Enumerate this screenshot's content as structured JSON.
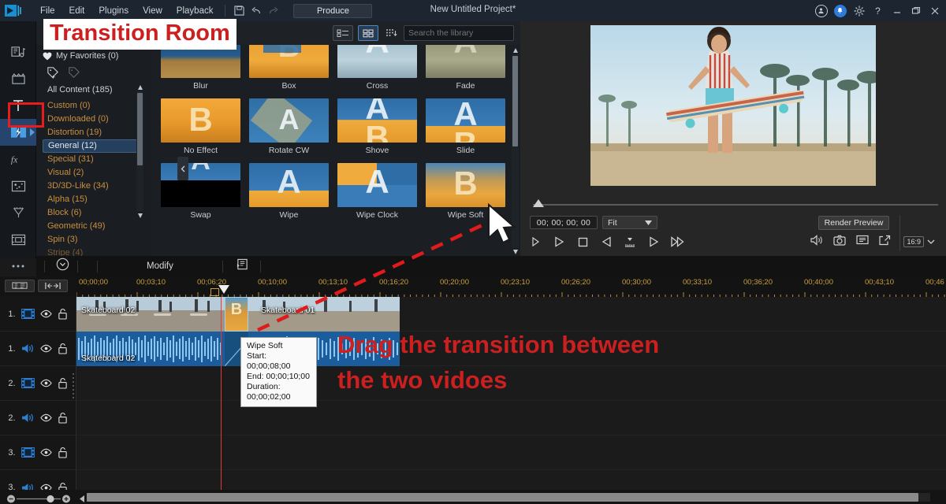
{
  "app": {
    "project_title": "New Untitled Project*",
    "logo_icon": "powerdirector-logo-icon"
  },
  "menubar": {
    "items": [
      {
        "label": "File"
      },
      {
        "label": "Edit"
      },
      {
        "label": "Plugins"
      },
      {
        "label": "View"
      },
      {
        "label": "Playback"
      }
    ],
    "save_icon": "save-disk-icon",
    "undo_icon": "undo-arrow-icon",
    "redo_icon": "redo-arrow-icon",
    "produce_label": "Produce"
  },
  "window_controls": {
    "account_icon": "account-circle-icon",
    "notification_icon": "bell-icon",
    "settings_icon": "gear-icon",
    "help_label": "?",
    "minimize_label": "—",
    "maximize_label": "❐",
    "close_label": "✕",
    "notification_color": "#2f7bdc"
  },
  "rail": {
    "items": [
      {
        "name": "media-room",
        "icon": "media-note-icon"
      },
      {
        "name": "effect-room",
        "icon": "clapper-board-icon"
      },
      {
        "name": "title-room",
        "icon": "text-t-icon"
      },
      {
        "name": "transition-room",
        "icon": "transition-icon",
        "active": true
      },
      {
        "name": "audio-mixing-room",
        "icon": "fx-icon"
      },
      {
        "name": "particle-room",
        "icon": "particle-icon"
      },
      {
        "name": "subtitle-room",
        "icon": "magic-wand-icon"
      },
      {
        "name": "chapter-room",
        "icon": "frame-icon"
      },
      {
        "name": "more-rooms",
        "icon": "ellipsis-icon"
      }
    ]
  },
  "library": {
    "view_list_icon": "list-view-icon",
    "view_grid_icon": "grid-view-icon",
    "sort_icon": "sort-download-icon",
    "search_placeholder": "Search the library",
    "search_value": "",
    "search_icon": "search-icon",
    "favorites_label": "My Favorites (0)",
    "favorites_icon": "heart-icon",
    "tag_add_icon": "tag-plus-icon",
    "tag_icon": "tag-icon",
    "all_content_label": "All Content (185)",
    "collapse_icon": "chevron-left-icon",
    "categories": [
      {
        "label": "Custom  (0)",
        "selected": false
      },
      {
        "label": "Downloaded  (0)",
        "selected": false
      },
      {
        "label": "Distortion  (19)",
        "selected": false
      },
      {
        "label": "General  (12)",
        "selected": true
      },
      {
        "label": "Special  (31)",
        "selected": false
      },
      {
        "label": "Visual  (2)",
        "selected": false
      },
      {
        "label": "3D/3D-Like  (34)",
        "selected": false
      },
      {
        "label": "Alpha  (15)",
        "selected": false
      },
      {
        "label": "Block  (6)",
        "selected": false
      },
      {
        "label": "Geometric  (49)",
        "selected": false
      },
      {
        "label": "Spin  (3)",
        "selected": false
      },
      {
        "label": "Stripe  (4)",
        "selected": false
      }
    ],
    "transitions": [
      {
        "label": "Blur",
        "style": "blur"
      },
      {
        "label": "Box",
        "style": "box"
      },
      {
        "label": "Cross",
        "style": "cross"
      },
      {
        "label": "Fade",
        "style": "fade"
      },
      {
        "label": "No Effect",
        "style": "noeffect"
      },
      {
        "label": "Rotate CW",
        "style": "rotatecw"
      },
      {
        "label": "Shove",
        "style": "shove"
      },
      {
        "label": "Slide",
        "style": "slide"
      },
      {
        "label": "Swap",
        "style": "swap"
      },
      {
        "label": "Wipe",
        "style": "wipe"
      },
      {
        "label": "Wipe Clock",
        "style": "wipeclock"
      },
      {
        "label": "Wipe Soft",
        "style": "wipesoft"
      }
    ]
  },
  "preview": {
    "timecode": "00; 00; 00; 00",
    "fit_label": "Fit",
    "fit_caret_icon": "chevron-down-icon",
    "render_preview_label": "Render Preview",
    "aspect_ratio_label": "16:9",
    "aspect_caret_icon": "chevron-down-icon",
    "transport": [
      {
        "name": "play-button",
        "icon": "play-icon"
      },
      {
        "name": "stop-button",
        "icon": "stop-icon"
      },
      {
        "name": "previous-frame-button",
        "icon": "prev-frame-icon"
      },
      {
        "name": "step-button",
        "icon": "step-marker-icon"
      },
      {
        "name": "next-frame-button",
        "icon": "next-frame-icon"
      },
      {
        "name": "fast-forward-button",
        "icon": "fast-forward-icon"
      }
    ],
    "right_controls": [
      {
        "name": "volume-button",
        "icon": "speaker-icon"
      },
      {
        "name": "snapshot-button",
        "icon": "camera-icon"
      },
      {
        "name": "display-options-button",
        "icon": "display-icon"
      },
      {
        "name": "undock-button",
        "icon": "popout-icon"
      }
    ]
  },
  "modify_bar": {
    "expand_icon": "chevron-down-circle-icon",
    "modify_label": "Modify",
    "designer_icon": "designer-panel-icon"
  },
  "timeline": {
    "tools": [
      {
        "name": "track-manager-button",
        "icon": "track-manager-icon"
      },
      {
        "name": "marker-button",
        "icon": "range-marker-icon"
      }
    ],
    "ruler_labels": [
      "00;00;00",
      "00;03;10",
      "00;06;20",
      "00;10;00",
      "00;13;10",
      "00;16;20",
      "00;20;00",
      "00;23;10",
      "00;26;20",
      "00;30;00",
      "00;33;10",
      "00;36;20",
      "00;40;00",
      "00;43;10",
      "00;46"
    ],
    "tracks": [
      {
        "num": "1.",
        "type": "video",
        "eye_icon": "eye-icon",
        "lock_icon": "unlock-icon"
      },
      {
        "num": "1.",
        "type": "audio",
        "eye_icon": "eye-icon",
        "lock_icon": "unlock-icon"
      },
      {
        "num": "2.",
        "type": "video",
        "eye_icon": "eye-icon",
        "lock_icon": "unlock-icon"
      },
      {
        "num": "2.",
        "type": "audio",
        "eye_icon": "eye-icon",
        "lock_icon": "unlock-icon"
      },
      {
        "num": "3.",
        "type": "video",
        "eye_icon": "eye-icon",
        "lock_icon": "unlock-icon"
      },
      {
        "num": "3.",
        "type": "audio",
        "eye_icon": "eye-icon",
        "lock_icon": "unlock-icon"
      }
    ],
    "clips": [
      {
        "label": "Skateboard 02",
        "track": "video1"
      },
      {
        "label": "Skateboard 01",
        "track": "video1"
      },
      {
        "label": "Skateboard 02",
        "track": "audio1"
      }
    ],
    "zoom_out_icon": "minus-circle-icon",
    "zoom_in_icon": "plus-circle-icon",
    "scroll_left_icon": "triangle-left-icon"
  },
  "tooltip": {
    "title": "Wipe Soft",
    "start": "Start: 00;00;08;00",
    "end": "End: 00;00;10;00",
    "duration": "Duration: 00;00;02;00"
  },
  "annotations": {
    "title_banner": "Transition Room",
    "instruction_line1": "Drag the transition between",
    "instruction_line2": "the two vidoes",
    "accent_color": "#cc1f1f",
    "highlight_box_color": "#e81c1c",
    "cursor_icon": "mouse-pointer-icon"
  }
}
